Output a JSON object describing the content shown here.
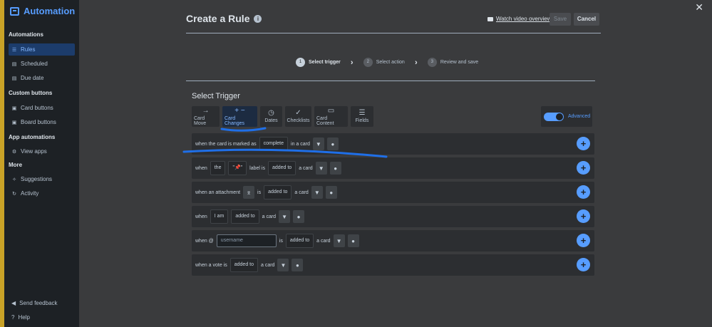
{
  "sidebar": {
    "title": "Automation",
    "sections": [
      {
        "label": "Automations",
        "items": [
          {
            "label": "Rules",
            "icon": "sliders-icon",
            "active": true
          },
          {
            "label": "Scheduled",
            "icon": "calendar-icon"
          },
          {
            "label": "Due date",
            "icon": "calendar-icon"
          }
        ]
      },
      {
        "label": "Custom buttons",
        "items": [
          {
            "label": "Card buttons",
            "icon": "card-icon"
          },
          {
            "label": "Board buttons",
            "icon": "board-icon"
          }
        ]
      },
      {
        "label": "App automations",
        "items": [
          {
            "label": "View apps",
            "icon": "gear-icon"
          }
        ]
      },
      {
        "label": "More",
        "items": [
          {
            "label": "Suggestions",
            "icon": "sparkle-icon"
          },
          {
            "label": "Activity",
            "icon": "refresh-icon"
          }
        ]
      }
    ],
    "bottom": [
      {
        "label": "Send feedback",
        "icon": "megaphone-icon"
      },
      {
        "label": "Help",
        "icon": "help-icon"
      }
    ]
  },
  "header": {
    "title": "Create a Rule",
    "watch_video": "Watch video overview",
    "save": "Save",
    "cancel": "Cancel"
  },
  "steps": [
    {
      "num": "1",
      "label": "Select trigger",
      "current": true
    },
    {
      "num": "2",
      "label": "Select action"
    },
    {
      "num": "3",
      "label": "Review and save"
    }
  ],
  "trigger": {
    "heading": "Select Trigger",
    "tabs": [
      {
        "label": "Card Move",
        "glyph": "→"
      },
      {
        "label": "Card Changes",
        "glyph": "+ −",
        "selected": true
      },
      {
        "label": "Dates",
        "glyph": "◷"
      },
      {
        "label": "Checklists",
        "glyph": "✓"
      },
      {
        "label": "Card Content",
        "glyph": "▭"
      },
      {
        "label": "Fields",
        "glyph": "☰"
      }
    ],
    "advanced": "Advanced",
    "rows": {
      "r1": {
        "t1": "when the card is marked as",
        "c1": "complete",
        "t2": "in a card"
      },
      "r2": {
        "t1": "when",
        "c1": "the",
        "c2": "\"📌\"",
        "t2": "label is",
        "c3": "added to",
        "t3": "a card"
      },
      "r3": {
        "t1": "when an attachment",
        "t2": "is",
        "c1": "added to",
        "t3": "a card"
      },
      "r4": {
        "t1": "when",
        "c1": "I am",
        "c2": "added to",
        "t2": "a card"
      },
      "r5": {
        "t1": "when @",
        "ph": "username",
        "t2": "is",
        "c1": "added to",
        "t3": "a card"
      },
      "r6": {
        "t1": "when a vote is",
        "c1": "added to",
        "t2": "a card"
      }
    }
  },
  "colors": {
    "accent": "#579dff",
    "annotation": "#1f6fe8",
    "background": "#3a3b3d",
    "sidebar": "#1d2125"
  }
}
